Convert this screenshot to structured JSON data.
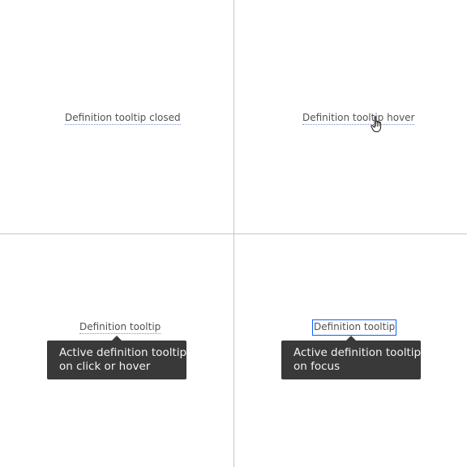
{
  "quadrants": {
    "closed": {
      "label": "Definition tooltip closed"
    },
    "hover": {
      "label": "Definition tooltip hover",
      "cursor_icon": "pointer-hand-icon"
    },
    "active_click": {
      "label": "Definition tooltip",
      "tooltip_line1": "Active definition tooltip",
      "tooltip_line2": "on click or hover"
    },
    "active_focus": {
      "label": "Definition tooltip",
      "tooltip_line1": "Active definition tooltip",
      "tooltip_line2": "on focus"
    }
  },
  "colors": {
    "divider": "#c6c6c6",
    "text": "#525252",
    "underline": "#7c8fc9",
    "tooltip_bg": "#393939",
    "tooltip_text": "#f4f4f4",
    "focus": "#0f62fe"
  }
}
